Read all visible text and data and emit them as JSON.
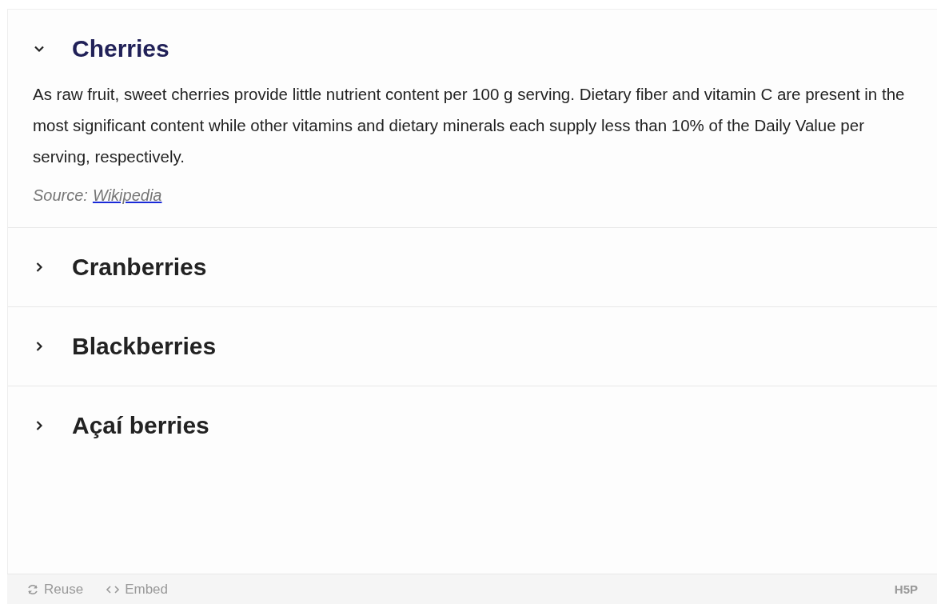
{
  "panels": [
    {
      "title": "Cherries",
      "expanded": true,
      "text": "As raw fruit, sweet cherries provide little nutrient content per 100 g serving. Dietary fiber and vitamin C are present in the most significant content while other vitamins and dietary minerals each supply less than 10% of the Daily Value per serving, respectively.",
      "source_label": "Source:",
      "source_link": "Wikipedia"
    },
    {
      "title": "Cranberries",
      "expanded": false
    },
    {
      "title": "Blackberries",
      "expanded": false
    },
    {
      "title": "Açaí berries",
      "expanded": false
    }
  ],
  "footer": {
    "reuse": "Reuse",
    "embed": "Embed",
    "logo": "H5P"
  }
}
